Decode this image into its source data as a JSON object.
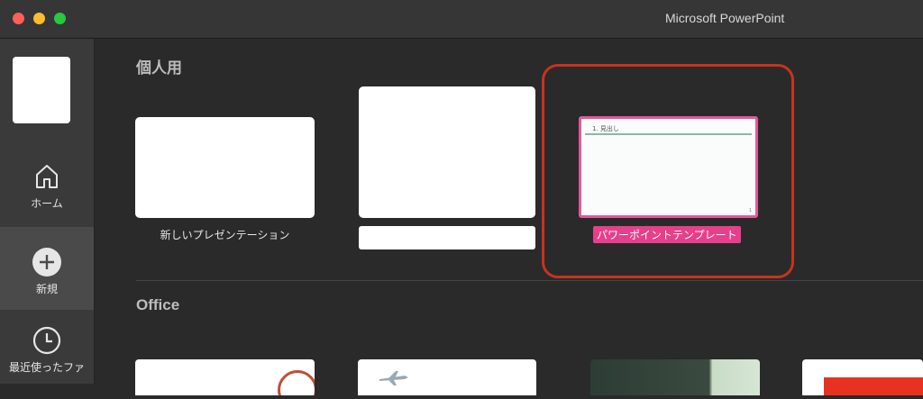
{
  "window": {
    "title": "Microsoft PowerPoint"
  },
  "sidebar": {
    "items": [
      {
        "label": "ホーム",
        "icon": "home-icon"
      },
      {
        "label": "新規",
        "icon": "plus-icon"
      },
      {
        "label": "最近使ったファ",
        "icon": "clock-icon"
      }
    ],
    "selected": "新規"
  },
  "sections": {
    "personal": {
      "title": "個人用",
      "templates": [
        {
          "caption": "新しいプレゼンテーション"
        },
        {
          "caption": ""
        },
        {
          "caption": "パワーポイントテンプレート",
          "selected": true,
          "preview_heading": "1. 見出し"
        }
      ]
    },
    "office": {
      "title": "Office"
    }
  },
  "colors": {
    "accent_pink": "#e83f8a",
    "highlight_red": "#c8321e",
    "background": "#2a2a2a",
    "sidebar": "#3a3a3a"
  }
}
